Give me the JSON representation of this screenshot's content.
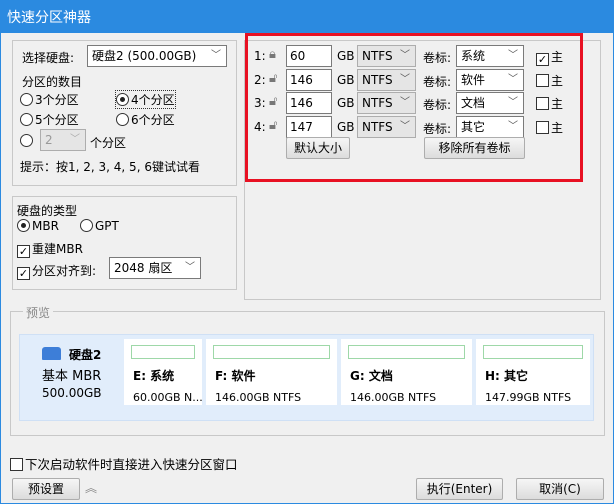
{
  "title": "快速分区神器",
  "disk_select": {
    "label": "选择硬盘:",
    "value": "硬盘2 (500.00GB)"
  },
  "count": {
    "label": "分区的数目",
    "options": [
      "3个分区",
      "4个分区",
      "5个分区",
      "6个分区"
    ],
    "selected": "4个分区",
    "custom_value": "2",
    "custom_suffix": "个分区"
  },
  "hint": "提示：按1, 2, 3, 4, 5, 6键试试看",
  "disk_type": {
    "label": "硬盘的类型",
    "mbr": "MBR",
    "gpt": "GPT",
    "selected": "MBR",
    "rebuild_mbr": "重建MBR",
    "rebuild_checked": true,
    "align_label": "分区对齐到:",
    "align_value": "2048 扇区",
    "align_checked": true
  },
  "partitions": [
    {
      "index": "1:",
      "size": "60",
      "unit": "GB",
      "fs": "NTFS",
      "label_text": "卷标:",
      "label": "系统",
      "primary_text": "主",
      "primary": true,
      "locked": true
    },
    {
      "index": "2:",
      "size": "146",
      "unit": "GB",
      "fs": "NTFS",
      "label_text": "卷标:",
      "label": "软件",
      "primary_text": "主",
      "primary": false,
      "locked": false
    },
    {
      "index": "3:",
      "size": "146",
      "unit": "GB",
      "fs": "NTFS",
      "label_text": "卷标:",
      "label": "文档",
      "primary_text": "主",
      "primary": false,
      "locked": false
    },
    {
      "index": "4:",
      "size": "147",
      "unit": "GB",
      "fs": "NTFS",
      "label_text": "卷标:",
      "label": "其它",
      "primary_text": "主",
      "primary": false,
      "locked": false
    }
  ],
  "buttons": {
    "default_size": "默认大小",
    "remove_labels": "移除所有卷标",
    "preset": "预设置",
    "execute": "执行(Enter)",
    "cancel": "取消(C)"
  },
  "preview": {
    "title": "预览",
    "disk_name": "硬盘2",
    "disk_type": "基本 MBR",
    "disk_size": "500.00GB",
    "parts": [
      {
        "name": "E: 系统",
        "info": "60.00GB N..."
      },
      {
        "name": "F: 软件",
        "info": "146.00GB NTFS"
      },
      {
        "name": "G: 文档",
        "info": "146.00GB NTFS"
      },
      {
        "name": "H: 其它",
        "info": "147.99GB NTFS"
      }
    ]
  },
  "startup_checkbox": "下次启动软件时直接进入快速分区窗口",
  "colors": {
    "titlebar": "#2b8ae0",
    "highlight": "#e81123"
  }
}
